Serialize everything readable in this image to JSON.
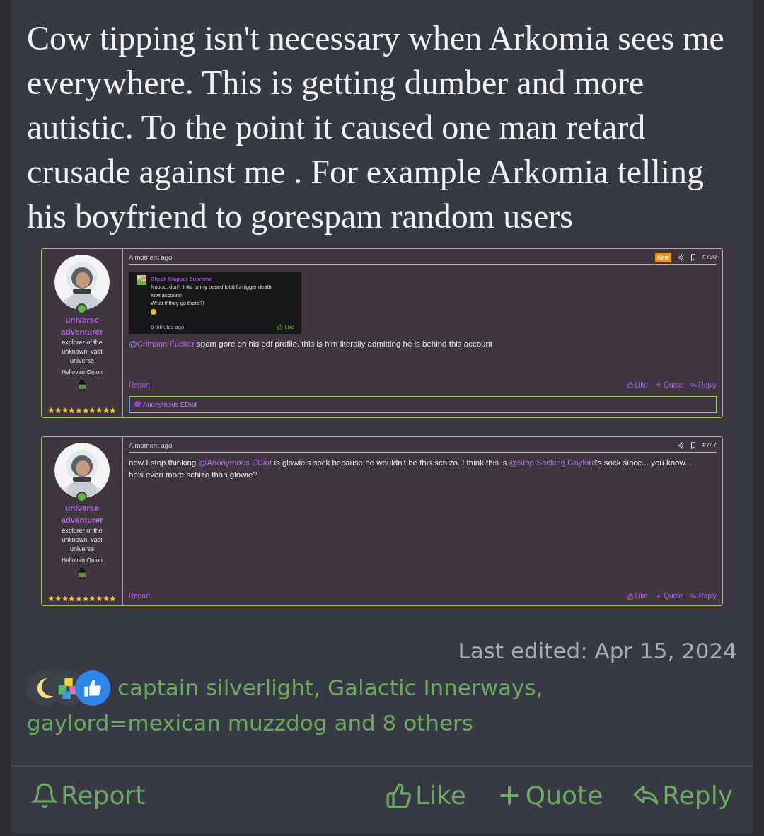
{
  "post": {
    "text": "Cow tipping isn't necessary when Arkomia sees me everywhere. This is getting dumber and more autistic. To the point it caused one man retard crusade against me . For example Arkomia telling his boyfriend to gorespam random users"
  },
  "embedded_posts": [
    {
      "user": {
        "name": "universe adventurer",
        "title": "explorer of the unknown, vast universe",
        "banner": "Hellovan Onion",
        "stars": 10
      },
      "time": "A moment ago",
      "badge": "New",
      "number": "#730",
      "quote": {
        "author": "Cheek Clapper Supreme",
        "lines": [
          "Noooo, don't links to my based total fumigger death",
          "Kiwi account!",
          "What if they go there?!"
        ],
        "time": "6 minutes ago",
        "like": "Like"
      },
      "body": [
        {
          "kind": "mention",
          "text": "@Crimson Fucker"
        },
        {
          "kind": "plain",
          "text": " spam gore on his edf profile. this is him literally admitting he is behind this account"
        }
      ],
      "report": "Report",
      "actions": [
        {
          "kind": "like",
          "label": "Like"
        },
        {
          "kind": "quote",
          "label": "Quote"
        },
        {
          "kind": "reply",
          "label": "Reply"
        }
      ],
      "signature": "Anonymous EDiot"
    },
    {
      "user": {
        "name": "universe adventurer",
        "title": "explorer of the unknown, vast universe",
        "banner": "Hellovan Onion",
        "stars": 10
      },
      "time": "A moment ago",
      "number": "#747",
      "body": [
        {
          "kind": "plain",
          "text": "now I stop thinking "
        },
        {
          "kind": "mention",
          "text": "@Anonymous EDiot"
        },
        {
          "kind": "plain",
          "text": " is glowie's sock because he wouldn't be this schizo. I think this is "
        },
        {
          "kind": "mention",
          "text": "@Stop Socking Gaylord"
        },
        {
          "kind": "plain",
          "text": "'s sock since... you know... he's even more schizo than glowie?"
        }
      ],
      "report": "Report",
      "actions": [
        {
          "kind": "like",
          "label": "Like"
        },
        {
          "kind": "quote",
          "label": "Quote"
        },
        {
          "kind": "reply",
          "label": "Reply"
        }
      ]
    }
  ],
  "last_edited": "Last edited: Apr 15, 2024",
  "reactions": {
    "items": [
      "captain silverlight,",
      "Galactic Innerways,",
      "gaylord=mexican muzzdog",
      "and 8 others"
    ]
  },
  "actions": [
    {
      "kind": "report",
      "label": "Report"
    },
    {
      "kind": "like",
      "label": "Like"
    },
    {
      "kind": "quote",
      "label": "Quote"
    },
    {
      "kind": "reply",
      "label": "Reply"
    }
  ]
}
